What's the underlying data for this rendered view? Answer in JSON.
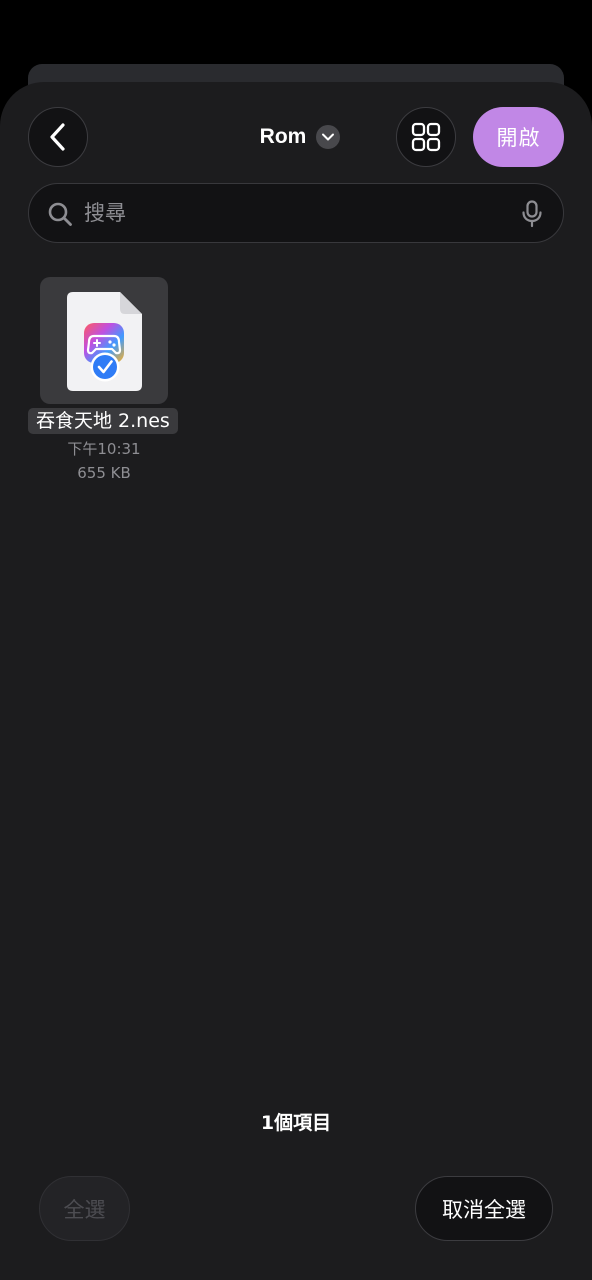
{
  "header": {
    "title": "Rom",
    "open_label": "開啟",
    "back_icon": "chevron-left-icon",
    "view_icon": "grid-view-icon",
    "title_menu_icon": "chevron-down-icon"
  },
  "search": {
    "placeholder": "搜尋",
    "value": "",
    "icon": "magnifier-icon",
    "mic_icon": "microphone-icon"
  },
  "files": [
    {
      "name": "吞食天地 2.nes",
      "time": "下午10:31",
      "size": "655 KB",
      "icon": "game-controller-file-icon",
      "selected": true
    }
  ],
  "footer": {
    "item_count": "1個項目",
    "select_all_label": "全選",
    "deselect_all_label": "取消全選"
  },
  "colors": {
    "background": "#1c1c1e",
    "accent": "#c187e6",
    "selected_check": "#2f7cf6",
    "secondary_text": "#8e8e93"
  }
}
